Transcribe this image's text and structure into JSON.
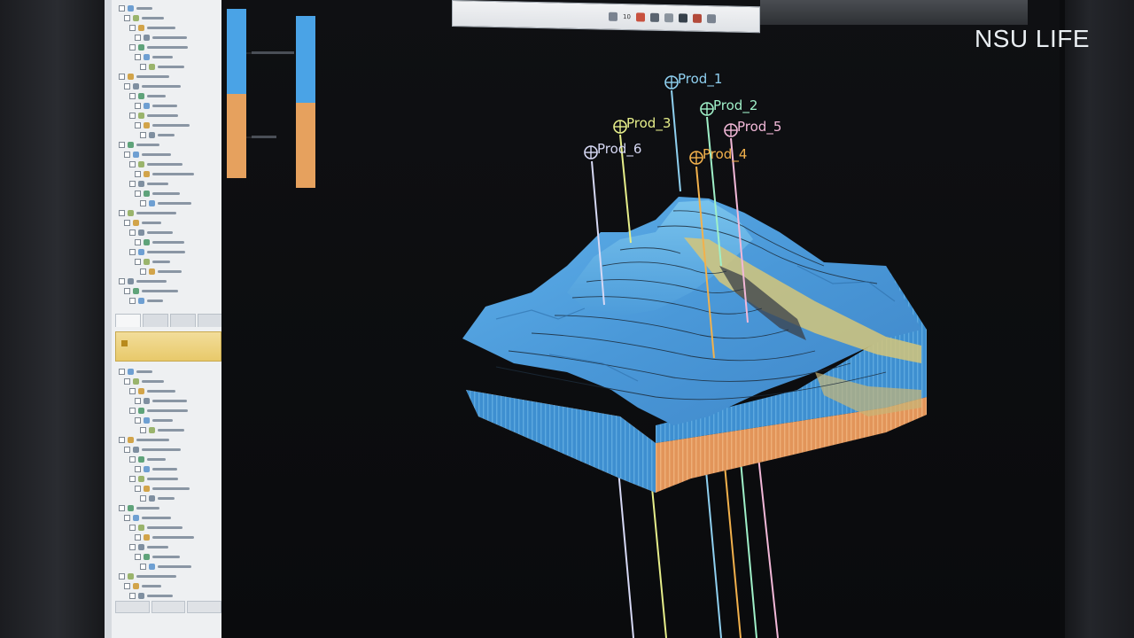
{
  "watermark": "NSU LIFE",
  "toolbar": {
    "number": "10"
  },
  "wells": [
    {
      "name": "Prod_1",
      "color": "#8fd0f0",
      "label": "Prod_1"
    },
    {
      "name": "Prod_2",
      "color": "#9ff0c8",
      "label": "Prod_2"
    },
    {
      "name": "Prod_3",
      "color": "#e6ee8a",
      "label": "Prod_3"
    },
    {
      "name": "Prod_4",
      "color": "#f2b14c",
      "label": "Prod_4"
    },
    {
      "name": "Prod_5",
      "color": "#f2b8d8",
      "label": "Prod_5"
    },
    {
      "name": "Prod_6",
      "color": "#d6d8f4",
      "label": "Prod_6"
    }
  ],
  "colors": {
    "zone_top": "#4aa3e6",
    "zone_bottom": "#e69d58",
    "surface": "#4f9fdc",
    "background": "#0d0e10"
  }
}
